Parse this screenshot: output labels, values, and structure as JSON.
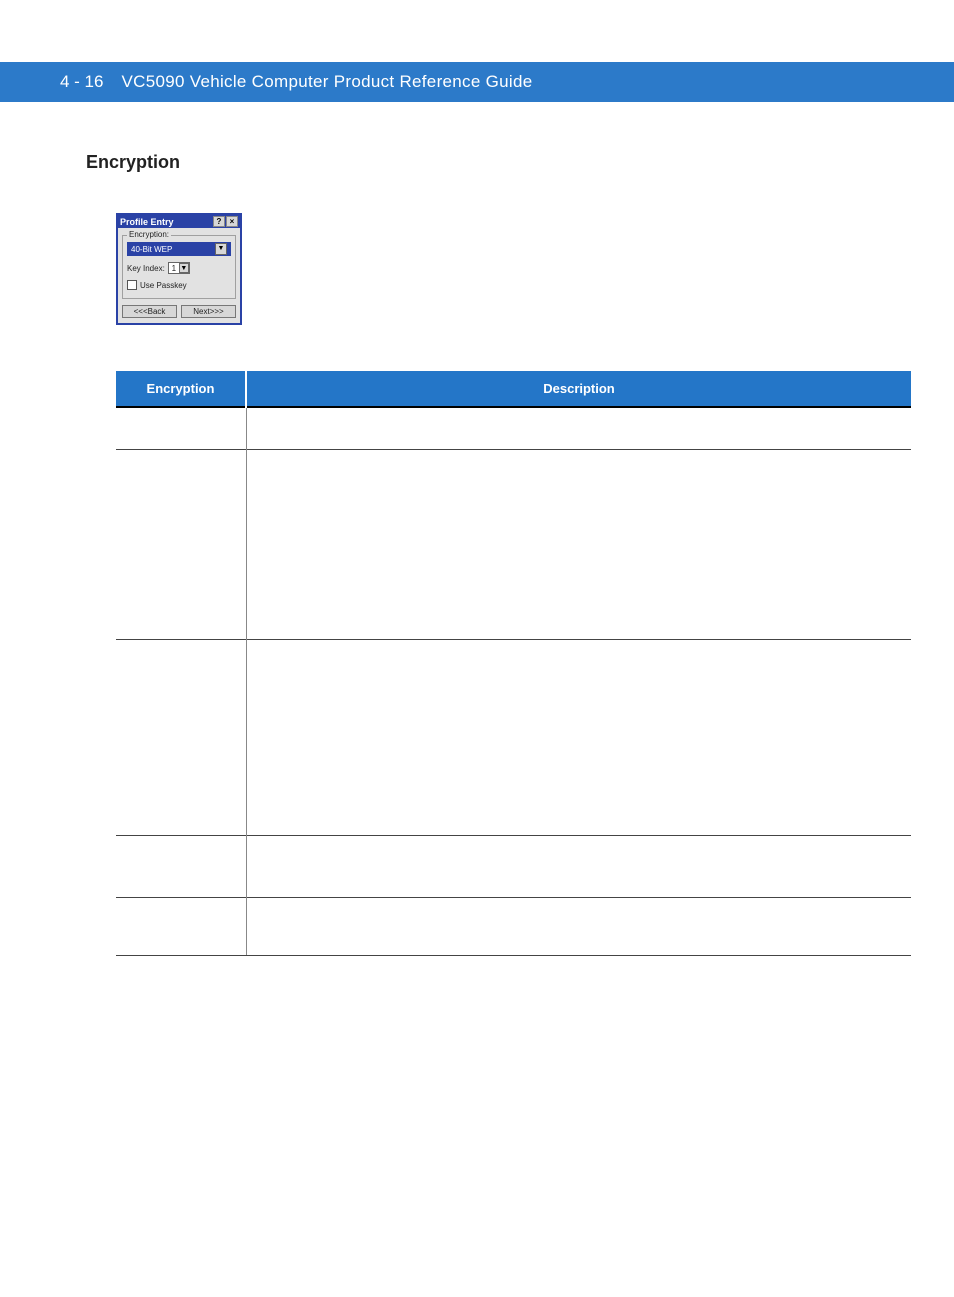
{
  "header": {
    "page_number": "4 - 16",
    "doc_title": "VC5090 Vehicle Computer Product Reference Guide"
  },
  "section": {
    "title": "Encryption"
  },
  "dialog": {
    "window_title": "Profile Entry",
    "help_glyph": "?",
    "close_glyph": "×",
    "group_label": "Encryption:",
    "encryption_value": "40-Bit WEP",
    "dropdown_glyph": "▼",
    "key_index_label": "Key Index:",
    "key_index_value": "1",
    "use_passkey_label": "Use Passkey",
    "back_label": "<<<Back",
    "next_label": "Next>>>"
  },
  "table": {
    "col_encryption": "Encryption",
    "col_description": "Description"
  }
}
